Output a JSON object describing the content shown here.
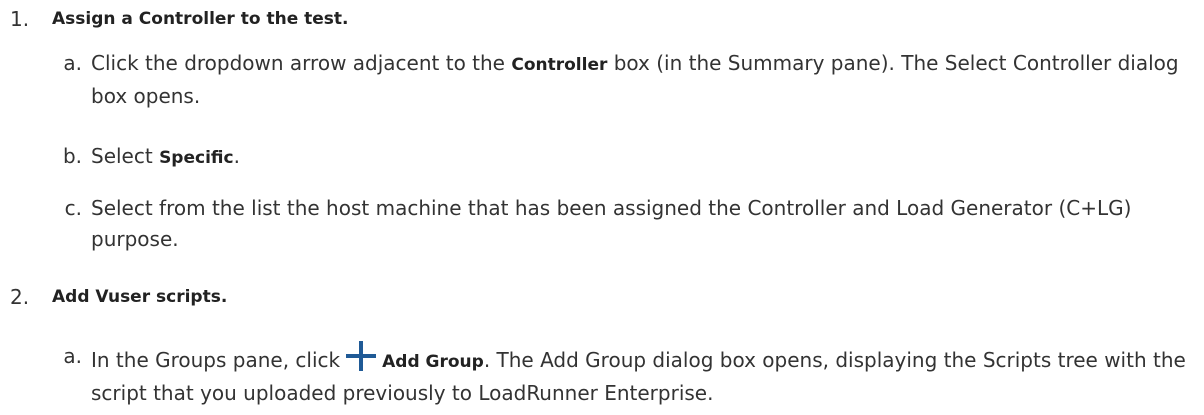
{
  "steps": [
    {
      "number": "1.",
      "title": "Assign a Controller to the test.",
      "substeps": [
        {
          "letter": "a.",
          "t1": "Click the dropdown arrow adjacent to the ",
          "bold1": "Controller",
          "t2": " box (in the Summary pane). The Select Controller dialog box opens."
        },
        {
          "letter": "b.",
          "t1": "Select ",
          "bold1": "Specific",
          "t2": "."
        },
        {
          "letter": "c.",
          "t1": "Select from the list the host machine that has been assigned the Controller and Load Generator (C+LG) purpose."
        }
      ]
    },
    {
      "number": "2.",
      "title": "Add Vuser scripts.",
      "substeps": [
        {
          "letter": "a.",
          "t1": "In the Groups pane, click",
          "icon": "plus-icon",
          "bold1": "Add Group",
          "t2": ". The Add Group dialog box opens, displaying the Scripts tree with the script that you uploaded previously to LoadRunner Enterprise."
        }
      ]
    }
  ],
  "colors": {
    "text": "#333333",
    "bold_text": "#222222",
    "icon": "#1f5a96"
  }
}
